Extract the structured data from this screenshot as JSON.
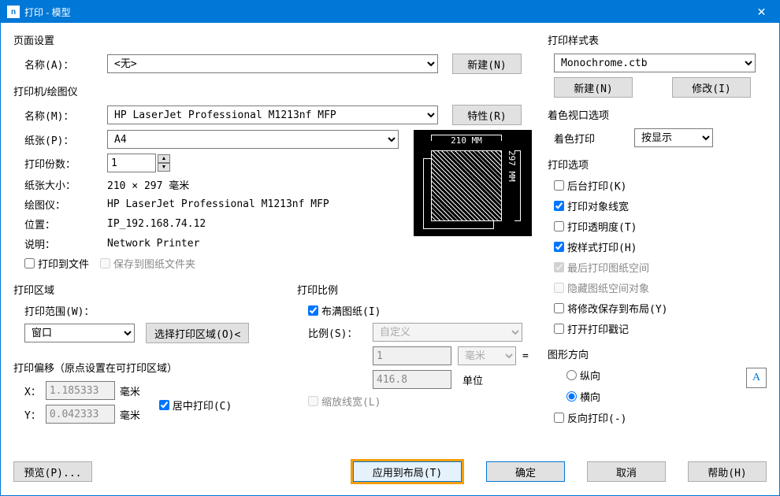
{
  "title": "打印 - 模型",
  "page_setup": {
    "title": "页面设置",
    "name_label": "名称(A)：",
    "name_value": "<无>",
    "new_btn": "新建(N)"
  },
  "printer": {
    "title": "打印机/绘图仪",
    "name_label": "名称(M)：",
    "name_value": "HP LaserJet Professional M1213nf MFP",
    "props_btn": "特性(R)",
    "paper_label": "纸张(P)：",
    "paper_value": "A4",
    "copies_label": "打印份数：",
    "copies_value": "1",
    "size_label": "纸张大小：",
    "size_value": "210 × 297  毫米",
    "plotter_label": "绘图仪：",
    "plotter_value": "HP LaserJet Professional M1213nf MFP",
    "location_label": "位置：",
    "location_value": "IP_192.168.74.12",
    "desc_label": "说明：",
    "desc_value": "Network Printer",
    "to_file_label": "打印到文件",
    "save_folder_label": "保存到图纸文件夹",
    "preview_top": "210 MM",
    "preview_right": "297 MM"
  },
  "area": {
    "title": "打印区域",
    "range_label": "打印范围(W)：",
    "range_value": "窗口",
    "select_btn": "选择打印区域(O)<"
  },
  "scale": {
    "title": "打印比例",
    "fit_label": "布满图纸(I)",
    "ratio_label": "比例(S)：",
    "ratio_value": "自定义",
    "num1": "1",
    "unit1": "毫米",
    "eq": "=",
    "num2": "416.8",
    "unit2": "单位",
    "scale_lw_label": "缩放线宽(L)"
  },
  "offset": {
    "title": "打印偏移（原点设置在可打印区域）",
    "x_label": "X：",
    "x_value": "1.185333",
    "x_unit": "毫米",
    "y_label": "Y：",
    "y_value": "0.042333",
    "y_unit": "毫米",
    "center_label": "居中打印(C)"
  },
  "style": {
    "title": "打印样式表",
    "value": "Monochrome.ctb",
    "new_btn": "新建(N)",
    "edit_btn": "修改(I)"
  },
  "shade": {
    "title": "着色视口选项",
    "label": "着色打印",
    "value": "按显示"
  },
  "options": {
    "title": "打印选项",
    "o1": "后台打印(K)",
    "o2": "打印对象线宽",
    "o3": "打印透明度(T)",
    "o4": "按样式打印(H)",
    "o5": "最后打印图纸空间",
    "o6": "隐藏图纸空间对象",
    "o7": "将修改保存到布局(Y)",
    "o8": "打开打印戳记"
  },
  "orient": {
    "title": "图形方向",
    "r1": "纵向",
    "r2": "横向",
    "flip": "反向打印(-)",
    "icon": "A"
  },
  "footer": {
    "preview": "预览(P)...",
    "apply": "应用到布局(T)",
    "ok": "确定",
    "cancel": "取消",
    "help": "帮助(H)"
  }
}
